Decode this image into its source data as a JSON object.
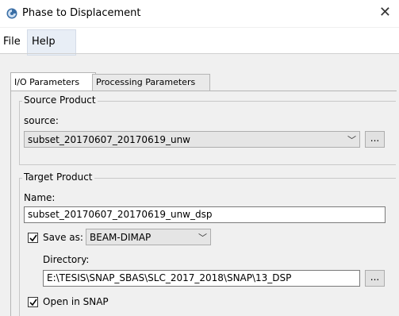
{
  "window": {
    "title": "Phase to Displacement"
  },
  "menu": {
    "file": "File",
    "help": "Help"
  },
  "tabs": [
    {
      "label": "I/O Parameters",
      "active": true
    },
    {
      "label": "Processing Parameters",
      "active": false
    }
  ],
  "source_product": {
    "group_title": "Source Product",
    "source_label": "source:",
    "source_value": "subset_20170607_20170619_unw",
    "browse_label": "..."
  },
  "target_product": {
    "group_title": "Target Product",
    "name_label": "Name:",
    "name_value": "subset_20170607_20170619_unw_dsp",
    "save_as_label": "Save as:",
    "save_as_checked": true,
    "format_value": "BEAM-DIMAP",
    "directory_label": "Directory:",
    "directory_value": "E:\\TESIS\\SNAP_SBAS\\SLC_2017_2018\\SNAP\\13_DSP",
    "browse_label": "...",
    "open_in_snap_label": "Open in SNAP",
    "open_in_snap_checked": true
  },
  "colors": {
    "accent": "#1e6fcf",
    "window_bg": "#f0f0f0"
  }
}
